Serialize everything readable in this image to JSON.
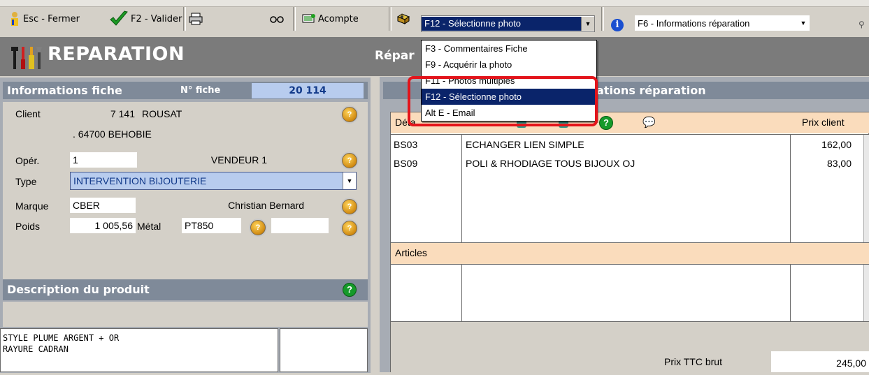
{
  "toolbar": {
    "close_label": "Esc - Fermer",
    "validate_label": "F2 - Valider",
    "deposit_label": "Acompte",
    "photo_select_value": "F12 - Sélectionne photo",
    "info_select_value": "F6 - Informations réparation"
  },
  "photo_menu": {
    "items": [
      "F3 - Commentaires Fiche",
      "F9 - Acquérir la photo",
      "F11 - Photos multiples",
      "F12 - Sélectionne photo",
      "Alt E - Email"
    ]
  },
  "header": {
    "title": "REPARATION",
    "subtitle": "Répar"
  },
  "info_fiche": {
    "heading": "Informations fiche",
    "fiche_label": "N° fiche",
    "fiche_number": "20 114",
    "client_label": "Client",
    "client_number": "7 141",
    "client_name": "ROUSAT",
    "client_address": ". 64700 BEHOBIE",
    "operator_label": "Opér.",
    "operator_number": "1",
    "operator_name": "VENDEUR 1",
    "type_label": "Type",
    "type_value": "INTERVENTION BIJOUTERIE",
    "brand_label": "Marque",
    "brand_code": "CBER",
    "brand_name": "Christian Bernard",
    "weight_label": "Poids",
    "weight_value": "1 005,56",
    "metal_label": "Métal",
    "metal_value": "PT850"
  },
  "description": {
    "heading": "Description du produit",
    "lines": [
      "STYLE PLUME ARGENT + OR",
      "RAYURE CADRAN"
    ]
  },
  "repair_info": {
    "heading": "ations réparation",
    "detail_label": "Déta",
    "price_header": "Prix client",
    "rows": [
      {
        "code": "BS03",
        "label": "ECHANGER LIEN SIMPLE",
        "price": "162,00"
      },
      {
        "code": "BS09",
        "label": "POLI & RHODIAGE TOUS BIJOUX OJ",
        "price": "83,00"
      }
    ],
    "articles_label": "Articles",
    "total_label": "Prix TTC brut",
    "total_value": "245,00"
  },
  "colors": {
    "selection": "#0a246a",
    "highlight": "#e3141b",
    "header_band": "#7b7b7b",
    "panel": "#a7acb4",
    "grid_header": "#fadcbc"
  }
}
